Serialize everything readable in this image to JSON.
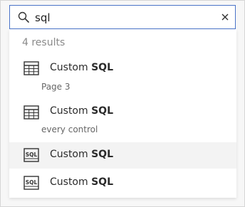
{
  "search": {
    "value": "sql",
    "placeholder": ""
  },
  "results": {
    "count_label": "4 results",
    "items": [
      {
        "title_prefix": "Custom ",
        "title_match": "SQL",
        "subtitle": "Page 3",
        "icon": "table-icon"
      },
      {
        "title_prefix": "Custom ",
        "title_match": "SQL",
        "subtitle": "every control",
        "icon": "table-icon"
      },
      {
        "title_prefix": "Custom ",
        "title_match": "SQL",
        "subtitle": "",
        "icon": "sql-icon"
      },
      {
        "title_prefix": "Custom ",
        "title_match": "SQL",
        "subtitle": "",
        "icon": "sql-icon"
      }
    ]
  },
  "colors": {
    "focus_border": "#4a73c8",
    "highlight_row": "#f3f3f3"
  }
}
